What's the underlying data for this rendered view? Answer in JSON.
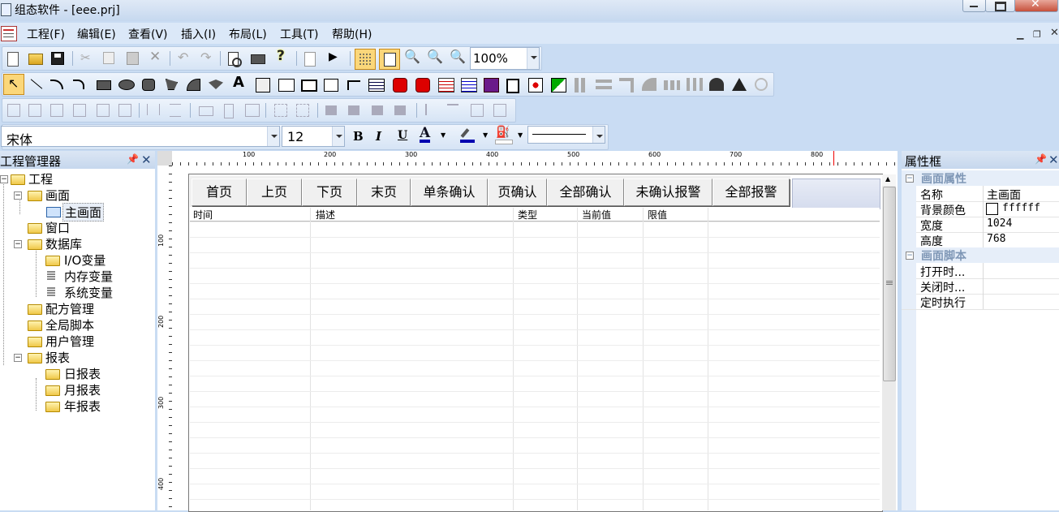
{
  "window": {
    "title": "组态软件 - [eee.prj]"
  },
  "menu": [
    "工程(F)",
    "编辑(E)",
    "查看(V)",
    "插入(I)",
    "布局(L)",
    "工具(T)",
    "帮助(H)"
  ],
  "toolbar": {
    "zoom": "100%"
  },
  "font_toolbar": {
    "font": "宋体",
    "size": "12",
    "bold": "B",
    "italic": "I",
    "underline": "U",
    "font_color": "A"
  },
  "left_panel": {
    "title": "工程管理器",
    "tree": [
      {
        "label": "工程",
        "level": 0
      },
      {
        "label": "画面",
        "level": 1
      },
      {
        "label": "主画面",
        "level": 2
      },
      {
        "label": "窗口",
        "level": 1
      },
      {
        "label": "数据库",
        "level": 1
      },
      {
        "label": "I/O变量",
        "level": 2
      },
      {
        "label": "内存变量",
        "level": 2
      },
      {
        "label": "系统变量",
        "level": 2
      },
      {
        "label": "配方管理",
        "level": 1
      },
      {
        "label": "全局脚本",
        "level": 1
      },
      {
        "label": "用户管理",
        "level": 1
      },
      {
        "label": "报表",
        "level": 1
      },
      {
        "label": "日报表",
        "level": 2
      },
      {
        "label": "月报表",
        "level": 2
      },
      {
        "label": "年报表",
        "level": 2
      }
    ]
  },
  "ruler": {
    "h_labels": [
      "100",
      "200",
      "300",
      "400",
      "500",
      "600",
      "700",
      "800"
    ],
    "v_labels": [
      "100",
      "200",
      "300",
      "400"
    ]
  },
  "alarm_buttons": [
    "首页",
    "上页",
    "下页",
    "末页",
    "单条确认",
    "页确认",
    "全部确认",
    "未确认报警",
    "全部报警"
  ],
  "alarm_columns": [
    "时间",
    "描述",
    "类型",
    "当前值",
    "限值"
  ],
  "right_panel": {
    "title": "属性框",
    "section1": "画面属性",
    "props": [
      {
        "key": "名称",
        "value": "主画面"
      },
      {
        "key": "背景颜色",
        "value": "ffffff"
      },
      {
        "key": "宽度",
        "value": "1024"
      },
      {
        "key": "高度",
        "value": "768"
      }
    ],
    "section2": "画面脚本",
    "scripts": [
      "打开时...",
      "关闭时...",
      "定时执行"
    ]
  }
}
